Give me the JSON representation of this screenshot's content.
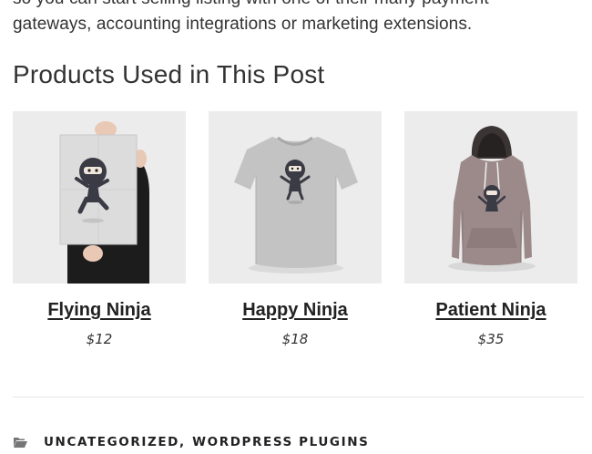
{
  "article": {
    "intro_line_1": "so you can start selling listing with one of their many payment",
    "intro_line_2": "gateways, accounting integrations or marketing extensions."
  },
  "products_section": {
    "title": "Products Used in This Post",
    "products": [
      {
        "name": "Flying Ninja",
        "price": "$12",
        "image": "ninja-poster"
      },
      {
        "name": "Happy Ninja",
        "price": "$18",
        "image": "ninja-tshirt"
      },
      {
        "name": "Patient Ninja",
        "price": "$35",
        "image": "ninja-hoodie"
      }
    ]
  },
  "post_meta": {
    "icon": "folder-icon",
    "categories": [
      "UNCATEGORIZED",
      "WORDPRESS PLUGINS"
    ],
    "separator": ","
  }
}
